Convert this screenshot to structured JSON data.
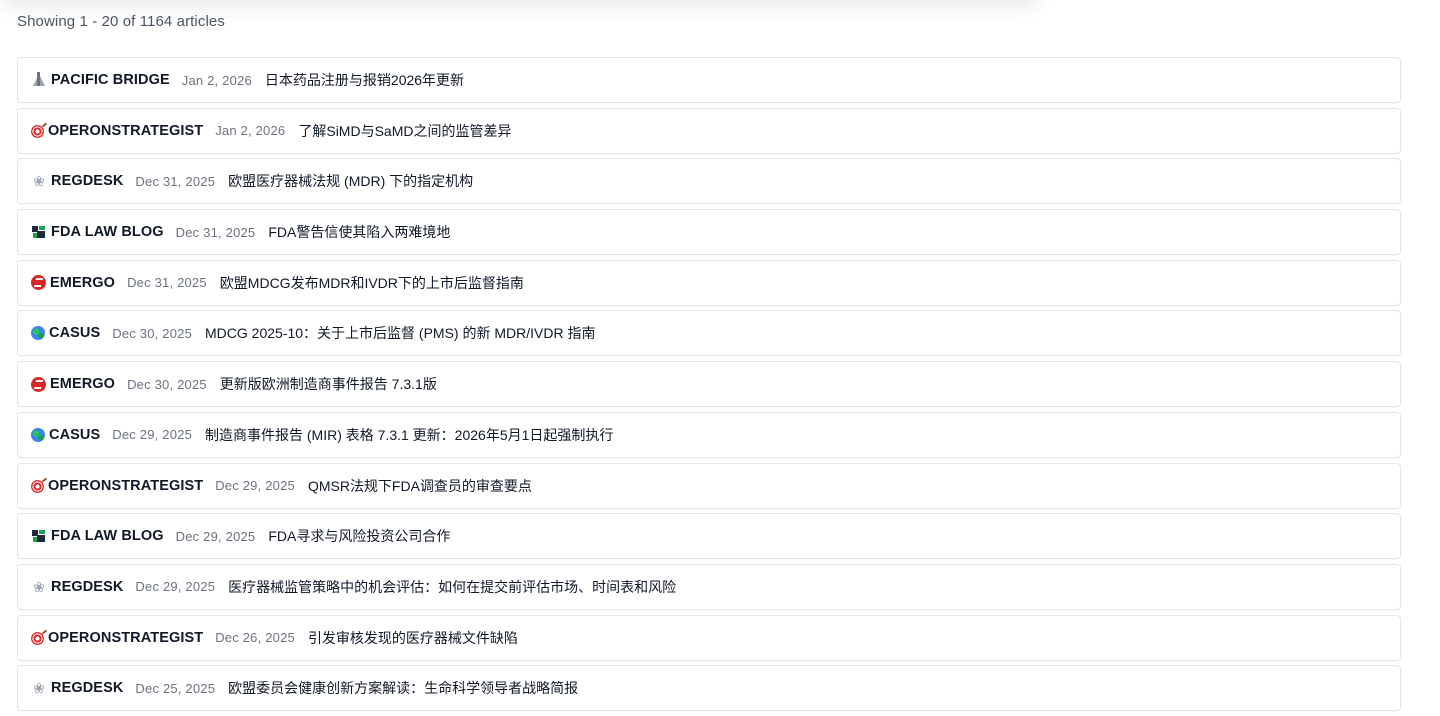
{
  "summary": "Showing 1 - 20 of 1164 articles",
  "articles": [
    {
      "icon": "pyramid-icon",
      "source": "PACIFIC BRIDGE",
      "date": "Jan 2, 2026",
      "title": "日本药品注册与报销2026年更新"
    },
    {
      "icon": "target-icon",
      "source": "OPERONSTRATEGIST",
      "date": "Jan 2, 2026",
      "title": "了解SiMD与SaMD之间的监管差异"
    },
    {
      "icon": "dove-icon",
      "source": "REGDESK",
      "date": "Dec 31, 2025",
      "title": "欧盟医疗器械法规 (MDR) 下的指定机构"
    },
    {
      "icon": "law-blog-icon",
      "source": "FDA LAW BLOG",
      "date": "Dec 31, 2025",
      "title": "FDA警告信使其陷入两难境地"
    },
    {
      "icon": "emergo-logo-icon",
      "source": "EMERGO",
      "date": "Dec 31, 2025",
      "title": "欧盟MDCG发布MDR和IVDR下的上市后监督指南"
    },
    {
      "icon": "globe-icon",
      "source": "CASUS",
      "date": "Dec 30, 2025",
      "title": "MDCG 2025-10：关于上市后监督 (PMS) 的新 MDR/IVDR 指南"
    },
    {
      "icon": "emergo-logo-icon",
      "source": "EMERGO",
      "date": "Dec 30, 2025",
      "title": "更新版欧洲制造商事件报告 7.3.1版"
    },
    {
      "icon": "globe-icon",
      "source": "CASUS",
      "date": "Dec 29, 2025",
      "title": "制造商事件报告 (MIR) 表格 7.3.1 更新：2026年5月1日起强制执行"
    },
    {
      "icon": "target-icon",
      "source": "OPERONSTRATEGIST",
      "date": "Dec 29, 2025",
      "title": "QMSR法规下FDA调查员的审查要点"
    },
    {
      "icon": "law-blog-icon",
      "source": "FDA LAW BLOG",
      "date": "Dec 29, 2025",
      "title": "FDA寻求与风险投资公司合作"
    },
    {
      "icon": "dove-icon",
      "source": "REGDESK",
      "date": "Dec 29, 2025",
      "title": "医疗器械监管策略中的机会评估：如何在提交前评估市场、时间表和风险"
    },
    {
      "icon": "target-icon",
      "source": "OPERONSTRATEGIST",
      "date": "Dec 26, 2025",
      "title": "引发审核发现的医疗器械文件缺陷"
    },
    {
      "icon": "dove-icon",
      "source": "REGDESK",
      "date": "Dec 25, 2025",
      "title": "欧盟委员会健康创新方案解读：生命科学领导者战略简报"
    }
  ]
}
